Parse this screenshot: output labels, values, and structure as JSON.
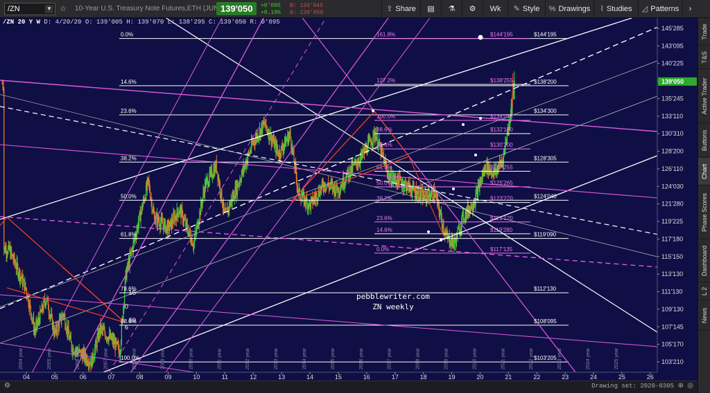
{
  "toolbar": {
    "symbol": "/ZN",
    "title": "10-Year U.S. Treasury Note Futures,ETH (JUN 20)",
    "price": "139'050",
    "change": "+0'085",
    "change_pct": "+0.19%",
    "bid": "B: 139'045",
    "ask": "A: 139'050",
    "share_label": "Share",
    "timeframe_label": "Wk",
    "style_label": "Style",
    "drawings_label": "Drawings",
    "studies_label": "Studies",
    "patterns_label": "Patterns"
  },
  "sidebar": {
    "tabs": [
      "Trade",
      "T&S",
      "Active Trader",
      "Buttons",
      "Chart",
      "Phase Scores",
      "Dashboard",
      "L 2",
      "News"
    ]
  },
  "chart_header": {
    "symbol": "/ZN 20 Y W",
    "info": "D: 4/20/20  O: 139'005  H: 139'070  L: 138'295  C: 139'050  R: 0'095"
  },
  "bottom": {
    "drawing_set": "Drawing set: 2020-0305"
  },
  "chart_data": {
    "type": "candlestick",
    "x_ticks": [
      "04",
      "05",
      "06",
      "07",
      "08",
      "09",
      "10",
      "11",
      "12",
      "13",
      "14",
      "15",
      "16",
      "17",
      "18",
      "19",
      "20",
      "21",
      "22",
      "23",
      "24",
      "25",
      "26"
    ],
    "year_labels": [
      "2004 year",
      "2005 year",
      "2006 year",
      "2007 year",
      "2008 year",
      "2009 year",
      "2010 year",
      "2011 year",
      "2012 year",
      "2013 year",
      "2014 year",
      "2015 year",
      "2016 year",
      "2017 year",
      "2018 year",
      "2019 year",
      "2020 year",
      "2021 year",
      "2022 year",
      "2023 year",
      "2024 year",
      "2025 year"
    ],
    "y_ticks": [
      "145'285",
      "143'095",
      "140'225",
      "138'075",
      "135'245",
      "133'110",
      "130'310",
      "128'200",
      "126'110",
      "124'030",
      "121'280",
      "119'225",
      "117'180",
      "115'150",
      "113'130",
      "111'130",
      "109'130",
      "107'145",
      "105'170",
      "103'210"
    ],
    "current_price": "139'050",
    "left_fib_levels": [
      {
        "pct": "0.0%",
        "value": "$144'195"
      },
      {
        "pct": "14.6%",
        "value": "$138'200"
      },
      {
        "pct": "23.6%",
        "value": "$134'300"
      },
      {
        "pct": "38.2%",
        "value": "$128'305"
      },
      {
        "pct": "50.0%",
        "value": "$124'040"
      },
      {
        "pct": "61.8%",
        "value": "$119'090"
      },
      {
        "pct": "78.6%",
        "value": "$112'130"
      },
      {
        "pct": "88.6%",
        "value": "$108'095"
      },
      {
        "pct": "100.0%",
        "value": "$103'205"
      }
    ],
    "right_fib_levels": [
      {
        "pct": "161.8%",
        "value": "$144'195"
      },
      {
        "pct": "127.2%",
        "value": "$138'255"
      },
      {
        "pct": "100.0%",
        "value": "$134'075"
      },
      {
        "pct": "88.6%",
        "value": "$132'180"
      },
      {
        "pct": "78.6%",
        "value": "$130'200"
      },
      {
        "pct": "61.8%",
        "value": "$127'255"
      },
      {
        "pct": "50.0%",
        "value": "$125'265"
      },
      {
        "pct": "38.2%",
        "value": "$123'270"
      },
      {
        "pct": "23.6%",
        "value": "$121'120"
      },
      {
        "pct": "14.6%",
        "value": "$119'280"
      },
      {
        "pct": "0.0%",
        "value": "$117'135"
      }
    ],
    "annotation_lines": [
      "pebblewriter.com",
      "ZN weekly"
    ],
    "small_labels": [
      "16",
      "0",
      "59",
      "6"
    ]
  }
}
